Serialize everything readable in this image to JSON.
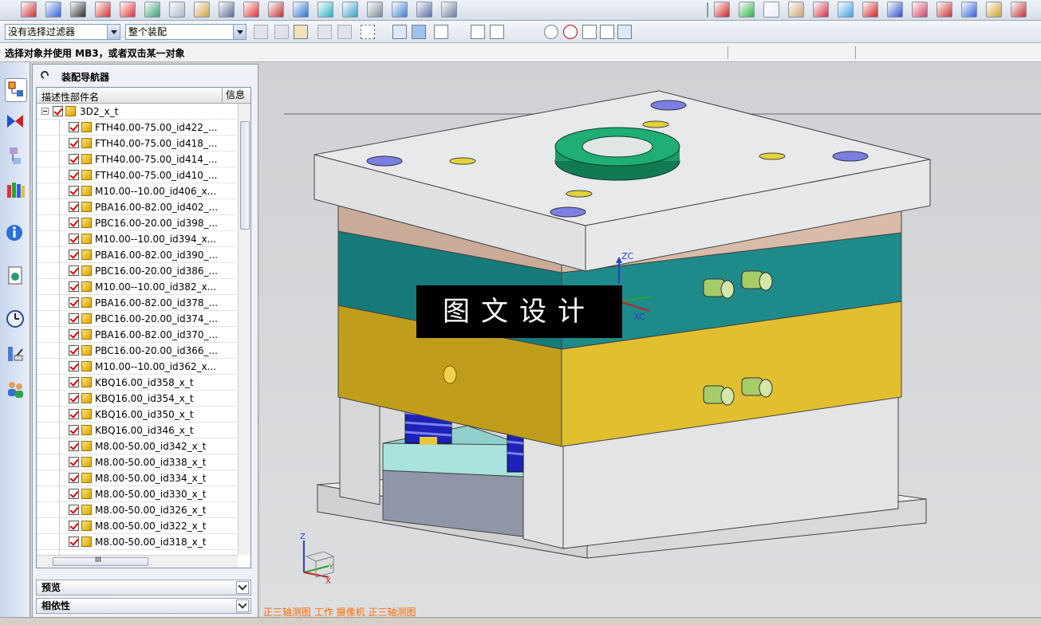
{
  "toolbar1": {
    "icons": [
      "sketch-icon",
      "rectangle-icon",
      "circle-icon",
      "pattern-icon",
      "scatter-icon",
      "edge-blend-icon",
      "layer-icon",
      "layer2-icon",
      "quarter-icon",
      "pin-icon",
      "bracket-icon",
      "boss-icon",
      "thermometer-icon",
      "marker-icon",
      "text-a-icon",
      "hatch-icon",
      "building-icon",
      "table-icon"
    ],
    "right_icons": [
      "red-cube-icon",
      "green-diamond-icon",
      "cube-icon",
      "house-icon",
      "mold-icon",
      "grid-color-icon",
      "explode-icon",
      "line-icon",
      "target-icon",
      "hatch-lines-icon",
      "grid-icon",
      "lines-color-icon",
      "edit-box-icon"
    ]
  },
  "toolbar2": {
    "filter_value": "没有选择过滤器",
    "scope_value": "整个装配"
  },
  "prompt": {
    "text": "选择对象并使用 MB3，或者双击某一对象"
  },
  "navigator": {
    "title": "装配导航器",
    "col_name": "描述性部件名",
    "col_info": "信息",
    "root": "3D2_x_t",
    "items": [
      "FTH40.00-75.00_id422_...",
      "FTH40.00-75.00_id418_...",
      "FTH40.00-75.00_id414_...",
      "FTH40.00-75.00_id410_...",
      "M10.00--10.00_id406_x...",
      "PBA16.00-82.00_id402_...",
      "PBC16.00-20.00_id398_...",
      "M10.00--10.00_id394_x...",
      "PBA16.00-82.00_id390_...",
      "PBC16.00-20.00_id386_...",
      "M10.00--10.00_id382_x...",
      "PBA16.00-82.00_id378_...",
      "PBC16.00-20.00_id374_...",
      "PBA16.00-82.00_id370_...",
      "PBC16.00-20.00_id366_...",
      "M10.00--10.00_id362_x...",
      "KBQ16.00_id358_x_t",
      "KBQ16.00_id354_x_t",
      "KBQ16.00_id350_x_t",
      "KBQ16.00_id346_x_t",
      "M8.00-50.00_id342_x_t",
      "M8.00-50.00_id338_x_t",
      "M8.00-50.00_id334_x_t",
      "M8.00-50.00_id330_x_t",
      "M8.00-50.00_id326_x_t",
      "M8.00-50.00_id322_x_t",
      "M8.00-50.00_id318_x_t"
    ],
    "scroll_label": "III",
    "section_preview": "预览",
    "section_dependency": "相依性"
  },
  "viewport": {
    "caption": "正三轴测图 工作 摄像机 正三轴测图",
    "watermark": "图文设计",
    "axis_zc": "ZC",
    "axis_xc": "XC",
    "triad_z": "Z",
    "triad_y": "Y",
    "triad_x": "X"
  },
  "colors": {
    "plate_top": "#e4e6e8",
    "plate_tan": "#d3b6a4",
    "plate_teal": "#1f8a8a",
    "plate_yellow": "#e0bc2c",
    "ring_green": "#1e9a66",
    "spring_blue": "#2a2ec8"
  }
}
